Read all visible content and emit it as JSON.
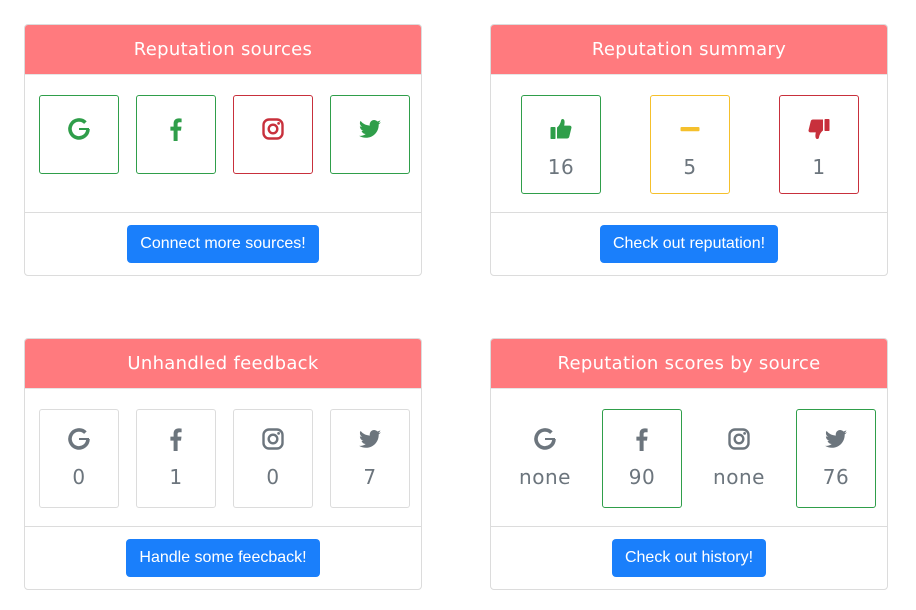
{
  "colors": {
    "header": "#ff7a7e",
    "button": "#1a7ffb",
    "green": "#2f9e4a",
    "red": "#c8303c",
    "yellow": "#f5c02c",
    "grey_text": "#6c757d"
  },
  "sources_card": {
    "title": "Reputation sources",
    "sources": [
      {
        "icon": "google-icon",
        "state": "connected"
      },
      {
        "icon": "facebook-icon",
        "state": "connected"
      },
      {
        "icon": "instagram-icon",
        "state": "disconnected"
      },
      {
        "icon": "twitter-icon",
        "state": "connected"
      }
    ],
    "button_label": "Connect more sources!"
  },
  "summary_card": {
    "title": "Reputation summary",
    "items": [
      {
        "icon": "thumbs-up-icon",
        "value": "16"
      },
      {
        "icon": "minus-icon",
        "value": "5"
      },
      {
        "icon": "thumbs-down-icon",
        "value": "1"
      }
    ],
    "button_label": "Check out reputation!"
  },
  "feedback_card": {
    "title": "Unhandled feedback",
    "items": [
      {
        "icon": "google-icon",
        "value": "0"
      },
      {
        "icon": "facebook-icon",
        "value": "1"
      },
      {
        "icon": "instagram-icon",
        "value": "0"
      },
      {
        "icon": "twitter-icon",
        "value": "7"
      }
    ],
    "button_label": "Handle some feecback!"
  },
  "scores_card": {
    "title": "Reputation scores by source",
    "items": [
      {
        "icon": "google-icon",
        "value": "none"
      },
      {
        "icon": "facebook-icon",
        "value": "90"
      },
      {
        "icon": "instagram-icon",
        "value": "none"
      },
      {
        "icon": "twitter-icon",
        "value": "76"
      }
    ],
    "button_label": "Check out history!"
  }
}
